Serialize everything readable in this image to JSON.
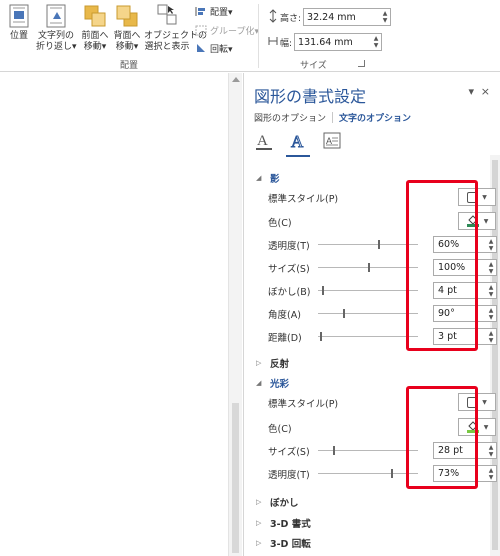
{
  "ribbon": {
    "position_label": "位置",
    "wrap_label_1": "文字列の",
    "wrap_label_2": "折り返し▾",
    "forward_label_1": "前面へ",
    "forward_label_2": "移動▾",
    "backward_label_1": "背面へ",
    "backward_label_2": "移動▾",
    "selection_label_1": "オブジェクトの",
    "selection_label_2": "選択と表示",
    "align_label": "配置▾",
    "group_label": "グループ化▾",
    "rotate_label": "回転▾",
    "arrange_group": "配置",
    "height_label": "高さ:",
    "height_value": "32.24 mm",
    "width_label": "幅:",
    "width_value": "131.64 mm",
    "size_group": "サイズ"
  },
  "pane": {
    "title": "図形の書式設定",
    "tab_shape": "図形のオプション",
    "tab_text": "文字のオプション",
    "close": "×",
    "dropdown": "▾"
  },
  "shadow": {
    "header": "影",
    "preset_label": "標準スタイル(P)",
    "color_label": "色(C)",
    "transparency_label": "透明度(T)",
    "transparency_value": "60%",
    "transparency_level": 0.6,
    "size_label": "サイズ(S)",
    "size_value": "100%",
    "size_level": 0.5,
    "blur_label": "ぼかし(B)",
    "blur_value": "4 pt",
    "blur_level": 0.04,
    "angle_label": "角度(A)",
    "angle_value": "90°",
    "angle_level": 0.25,
    "distance_label": "距離(D)",
    "distance_value": "3 pt",
    "distance_level": 0.02
  },
  "reflection": {
    "header": "反射"
  },
  "glow": {
    "header": "光彩",
    "preset_label": "標準スタイル(P)",
    "color_label": "色(C)",
    "size_label": "サイズ(S)",
    "size_value": "28 pt",
    "size_level": 0.15,
    "transparency_label": "透明度(T)",
    "transparency_value": "73%",
    "transparency_level": 0.73
  },
  "soft_edges": {
    "header": "ぼかし"
  },
  "format_3d": {
    "header": "3-D 書式"
  },
  "rotation_3d": {
    "header": "3-D 回転"
  },
  "colors": {
    "accent": "#2b579a",
    "highlight": "#e8001c",
    "swatch_shadow": "#2e8b57",
    "swatch_glow": "#7ac943"
  }
}
